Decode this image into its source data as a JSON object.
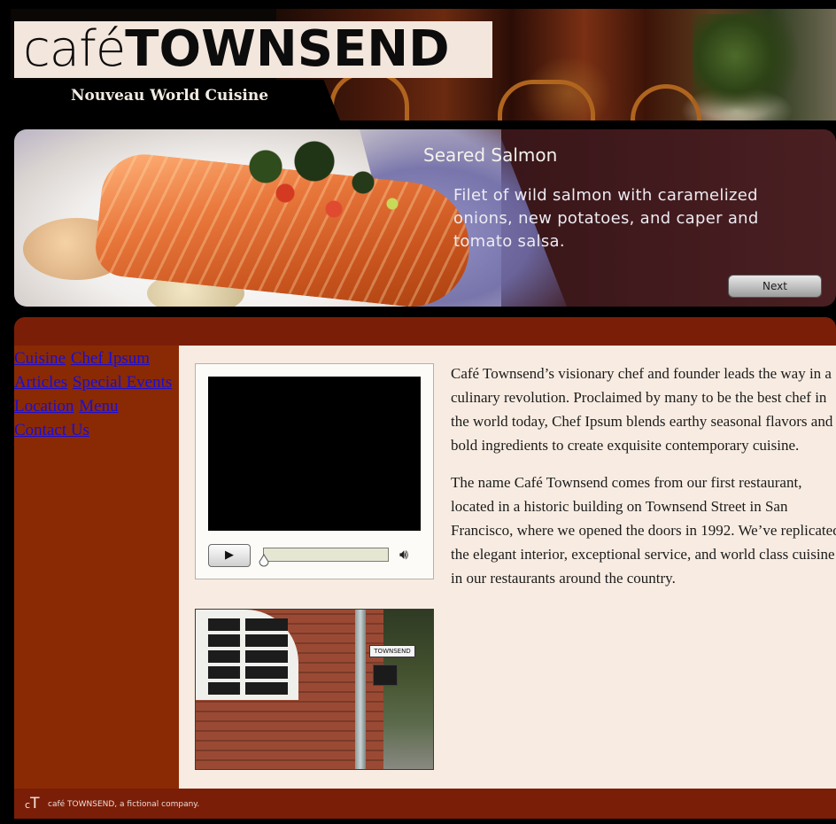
{
  "header": {
    "logo_cafe": "café",
    "logo_townsend": "TOWNSEND",
    "tagline": "Nouveau World Cuisine"
  },
  "feature": {
    "title": "Seared Salmon",
    "description": "Filet of wild salmon with caramelized onions, new potatoes, and caper and tomato salsa.",
    "next_label": "Next"
  },
  "nav": {
    "items": [
      {
        "label": "Cuisine"
      },
      {
        "label": "Chef Ipsum"
      },
      {
        "label": "Articles"
      },
      {
        "label": "Special Events"
      },
      {
        "label": "Location"
      },
      {
        "label": "Menu"
      },
      {
        "label": "Contact Us"
      }
    ]
  },
  "video_player": {
    "play_icon": "play-icon",
    "volume_icon": "speaker-icon",
    "progress": 0.0
  },
  "street_photo": {
    "sign_text": "TOWNSEND"
  },
  "content": {
    "paragraphs": [
      "Café Townsend’s visionary chef and founder leads the way in a culinary revolution. Proclaimed by many to be the best chef in the world today, Chef Ipsum blends earthy seasonal flavors and bold ingredients to create exquisite contemporary cuisine.",
      "The name Café Townsend comes from our first restaurant, located in a historic building on Townsend Street in San Francisco, where we opened the doors in 1992. We’ve replicated the elegant interior, exceptional service, and world class cuisine in our restaurants around the country."
    ]
  },
  "footer": {
    "mark_c": "c",
    "mark_t": "T",
    "text": "café TOWNSEND, a fictional company."
  },
  "colors": {
    "brand_maroon": "#7b1e08",
    "sidebar": "#8a2a04",
    "content_bg": "#f8ece2",
    "link": "#1a0dd6"
  }
}
